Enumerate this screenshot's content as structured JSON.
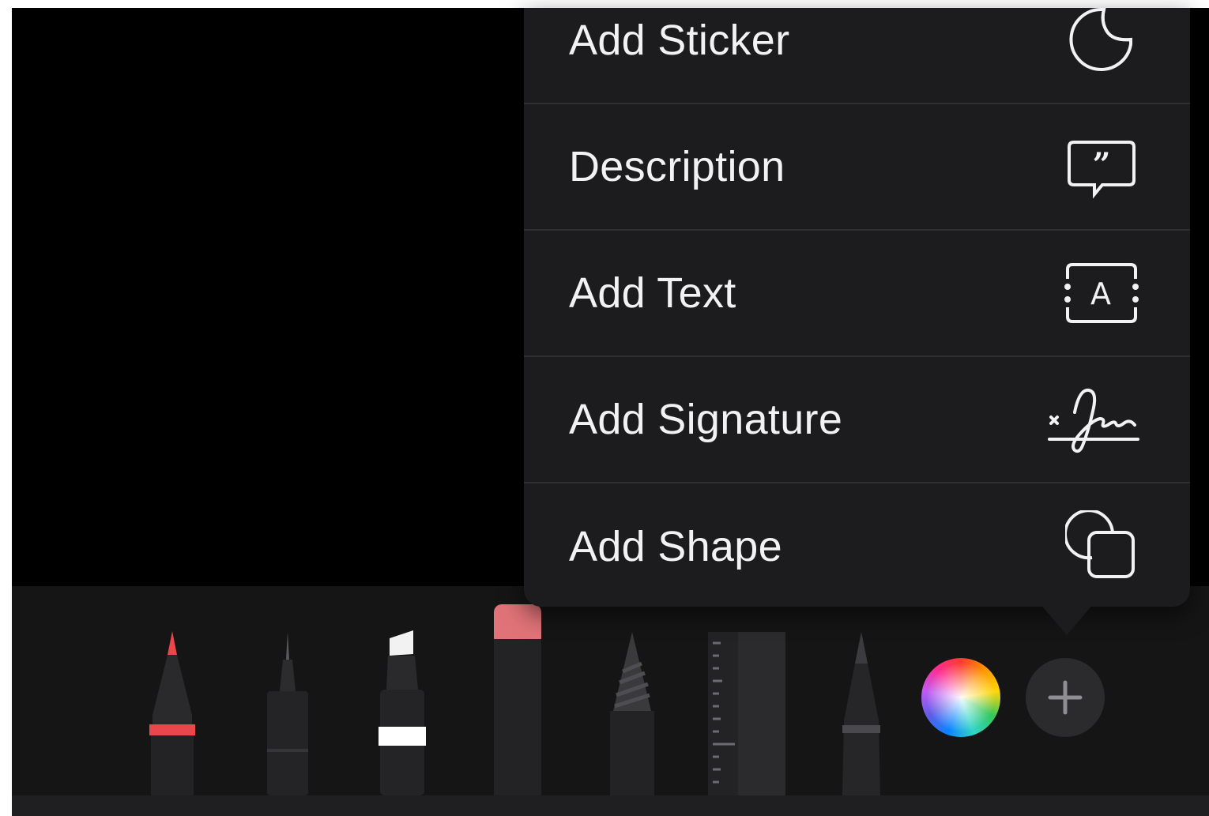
{
  "menu": {
    "items": [
      {
        "label": "Add Sticker",
        "icon": "sticker-icon"
      },
      {
        "label": "Description",
        "icon": "quote-bubble-icon"
      },
      {
        "label": "Add Text",
        "icon": "text-box-icon"
      },
      {
        "label": "Add Signature",
        "icon": "signature-icon"
      },
      {
        "label": "Add Shape",
        "icon": "shapes-icon"
      }
    ]
  },
  "toolbar": {
    "tools": [
      {
        "name": "pen",
        "accent": "#e9474b"
      },
      {
        "name": "fineliner",
        "accent": "#3a3a3d"
      },
      {
        "name": "marker",
        "accent": "#ffffff"
      },
      {
        "name": "eraser",
        "accent": "#e07378"
      },
      {
        "name": "pencil",
        "accent": "#3a3a3d"
      },
      {
        "name": "ruler",
        "accent": "#2a2a2c"
      },
      {
        "name": "fountain-pen",
        "accent": "#3a3a3d"
      }
    ],
    "color_picker": "color-wheel-icon",
    "add_button": "plus-icon"
  },
  "colors": {
    "canvas": "#000000",
    "menu_bg": "#1c1c1e",
    "menu_text": "#f2f2f4",
    "toolbar_bg": "#151516"
  }
}
